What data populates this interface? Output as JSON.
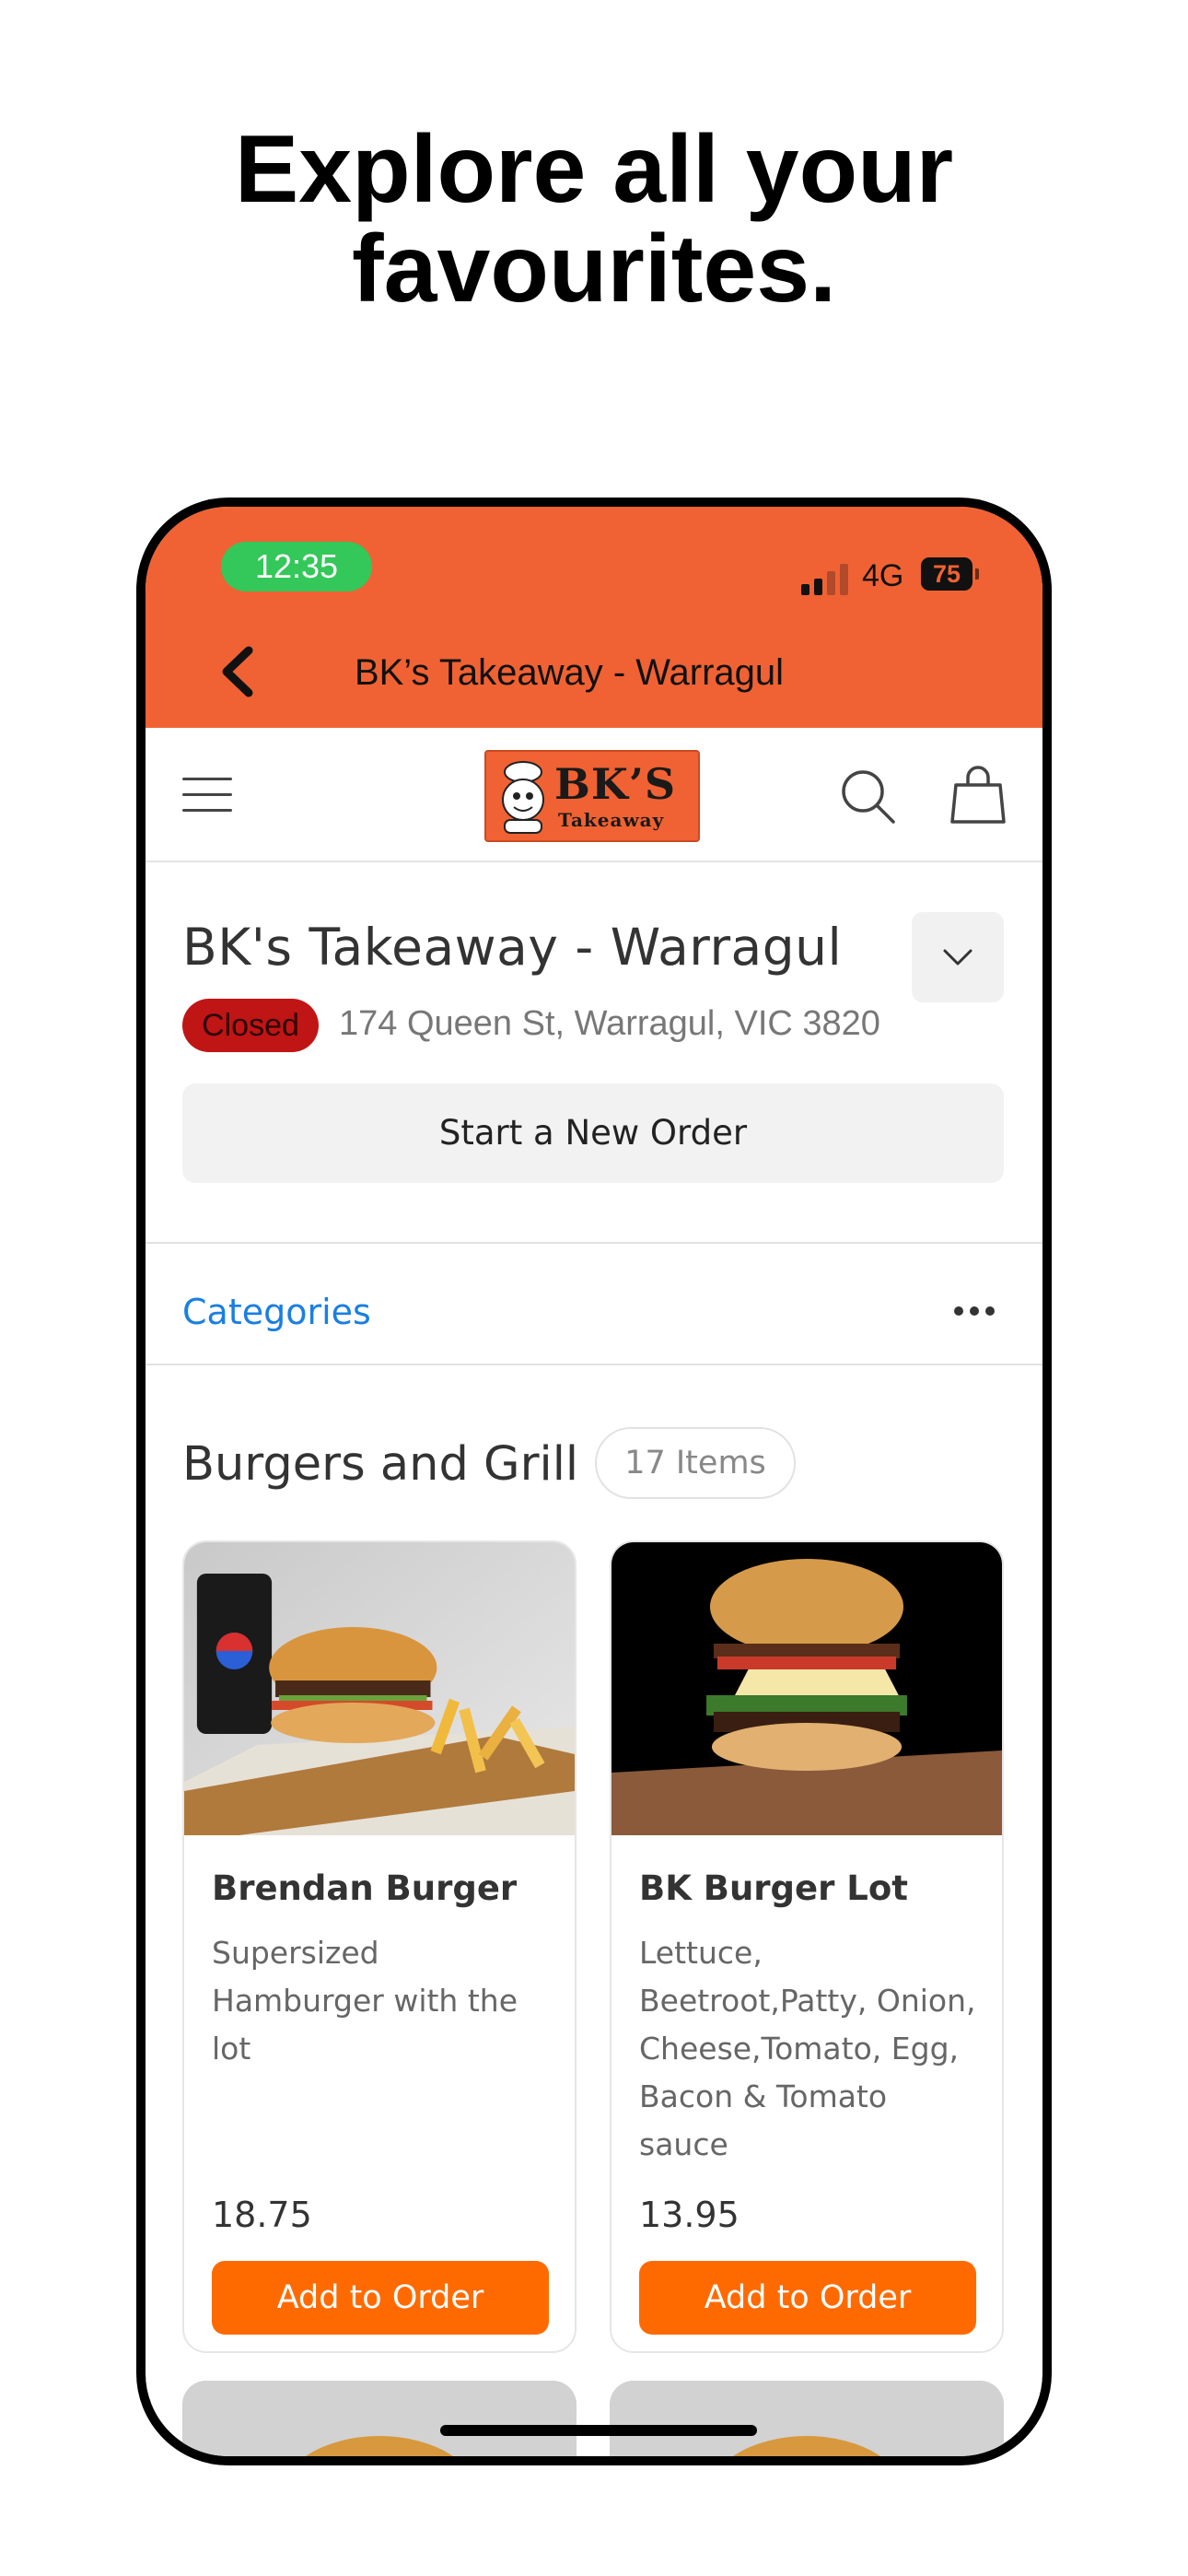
{
  "promo": {
    "headline_line1": "Explore all your",
    "headline_line2": "favourites."
  },
  "status_bar": {
    "time": "12:35",
    "network": "4G",
    "battery": "75"
  },
  "nav": {
    "title": "BK’s Takeaway - Warragul"
  },
  "header": {
    "logo_text": "BK’S",
    "logo_subtext": "Takeaway"
  },
  "store": {
    "name": "BK's Takeaway - Warragul",
    "status": "Closed",
    "address": "174 Queen St, Warragul, VIC 3820",
    "new_order_label": "Start a New Order"
  },
  "categories": {
    "label": "Categories"
  },
  "section": {
    "title": "Burgers and Grill",
    "count": "17 Items"
  },
  "products": [
    {
      "name": "Brendan Burger",
      "description": "Supersized Hamburger with the lot",
      "price": "18.75",
      "button": "Add to Order"
    },
    {
      "name": "BK Burger Lot",
      "description": "Lettuce, Beetroot,Patty, Onion, Cheese,Tomato, Egg, Bacon & Tomato sauce",
      "price": "13.95",
      "button": "Add to Order"
    }
  ],
  "colors": {
    "brand_orange": "#f06233",
    "button_orange": "#ff6a00",
    "closed_red": "#c01515",
    "link_blue": "#1a7fe0",
    "time_pill_green": "#34c759"
  },
  "icons": [
    "back-chevron-icon",
    "menu-icon",
    "search-icon",
    "shopping-bag-icon",
    "chevron-down-icon",
    "more-dots-icon"
  ]
}
